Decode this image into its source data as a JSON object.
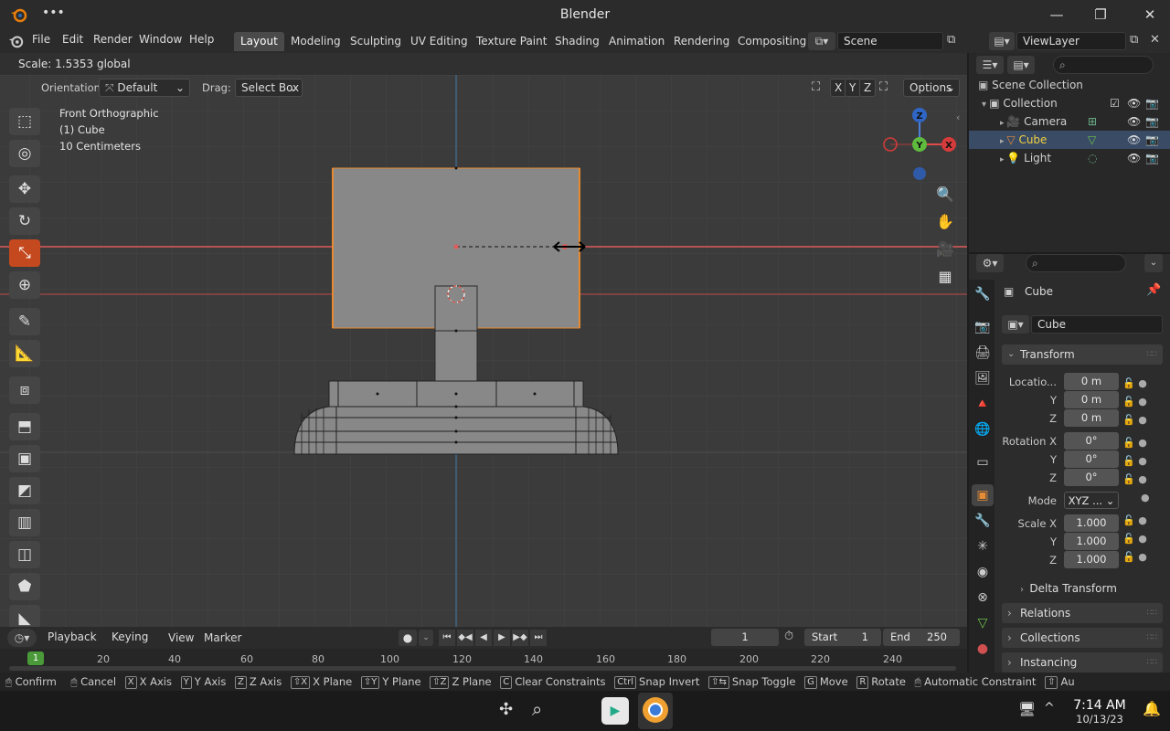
{
  "window": {
    "title": "Blender",
    "menu_dots": "•••",
    "minimize": "—",
    "maximize": "❐",
    "close": "✕"
  },
  "menus": [
    "File",
    "Edit",
    "Render",
    "Window",
    "Help"
  ],
  "workspaces": [
    "Layout",
    "Modeling",
    "Sculpting",
    "UV Editing",
    "Texture Paint",
    "Shading",
    "Animation",
    "Rendering",
    "Compositing"
  ],
  "scene": {
    "value": "Scene",
    "view_layer": "ViewLayer"
  },
  "operator_status": "Scale: 1.5353 global",
  "header": {
    "orientation_label": "Orientation:",
    "orientation_value": "Default",
    "drag_label": "Drag:",
    "drag_value": "Select Box",
    "axis_x": "X",
    "axis_y": "Y",
    "axis_z": "Z",
    "options": "Options"
  },
  "viewport_info": {
    "view": "Front Orthographic",
    "object": "(1) Cube",
    "scale": "10 Centimeters"
  },
  "gizmo": {
    "x": "X",
    "y": "Y",
    "z": "Z"
  },
  "outliner": {
    "scene_collection": "Scene Collection",
    "collection": "Collection",
    "items": [
      {
        "name": "Camera",
        "selected": false
      },
      {
        "name": "Cube",
        "selected": true
      },
      {
        "name": "Light",
        "selected": false
      }
    ]
  },
  "properties": {
    "object_name": "Cube",
    "datablock": "Cube",
    "transform": "Transform",
    "location_label": "Locatio...",
    "location": [
      "0 m",
      "0 m",
      "0 m"
    ],
    "rotation_label": "Rotation X",
    "rotation": [
      "0°",
      "0°",
      "0°"
    ],
    "mode_label": "Mode",
    "mode_value": "XYZ ...",
    "scale_label": "Scale X",
    "scale": [
      "1.000",
      "1.000",
      "1.000"
    ],
    "y_label": "Y",
    "z_label": "Z",
    "delta_transform": "Delta Transform",
    "relations": "Relations",
    "collections": "Collections",
    "instancing": "Instancing"
  },
  "timeline": {
    "playback": "Playback",
    "keying": "Keying",
    "view": "View",
    "marker": "Marker",
    "current_frame": "1",
    "start_label": "Start",
    "start": "1",
    "end_label": "End",
    "end": "250",
    "ticks": [
      "1",
      "20",
      "40",
      "60",
      "80",
      "100",
      "120",
      "140",
      "160",
      "180",
      "200",
      "220",
      "240"
    ]
  },
  "statusbar": [
    {
      "key": "",
      "label": "Confirm"
    },
    {
      "key": "",
      "label": "Cancel"
    },
    {
      "key": "X",
      "label": "X Axis"
    },
    {
      "key": "Y",
      "label": "Y Axis"
    },
    {
      "key": "Z",
      "label": "Z Axis"
    },
    {
      "key": "⇧X",
      "label": "X Plane"
    },
    {
      "key": "⇧Y",
      "label": "Y Plane"
    },
    {
      "key": "⇧Z",
      "label": "Z Plane"
    },
    {
      "key": "C",
      "label": "Clear Constraints"
    },
    {
      "key": "Ctrl",
      "label": "Snap Invert"
    },
    {
      "key": "⇧⇆",
      "label": "Snap Toggle"
    },
    {
      "key": "G",
      "label": "Move"
    },
    {
      "key": "R",
      "label": "Rotate"
    },
    {
      "key": "",
      "label": "Automatic Constraint"
    },
    {
      "key": "⇧",
      "label": "Au"
    }
  ],
  "taskbar": {
    "time": "7:14 AM",
    "date": "10/13/23"
  },
  "colors": {
    "accent": "#e58c34",
    "active_tool": "#c5491f",
    "x_axis": "#e04a4a",
    "y_axis": "#6cc24a",
    "z_axis": "#4a7fd8"
  }
}
